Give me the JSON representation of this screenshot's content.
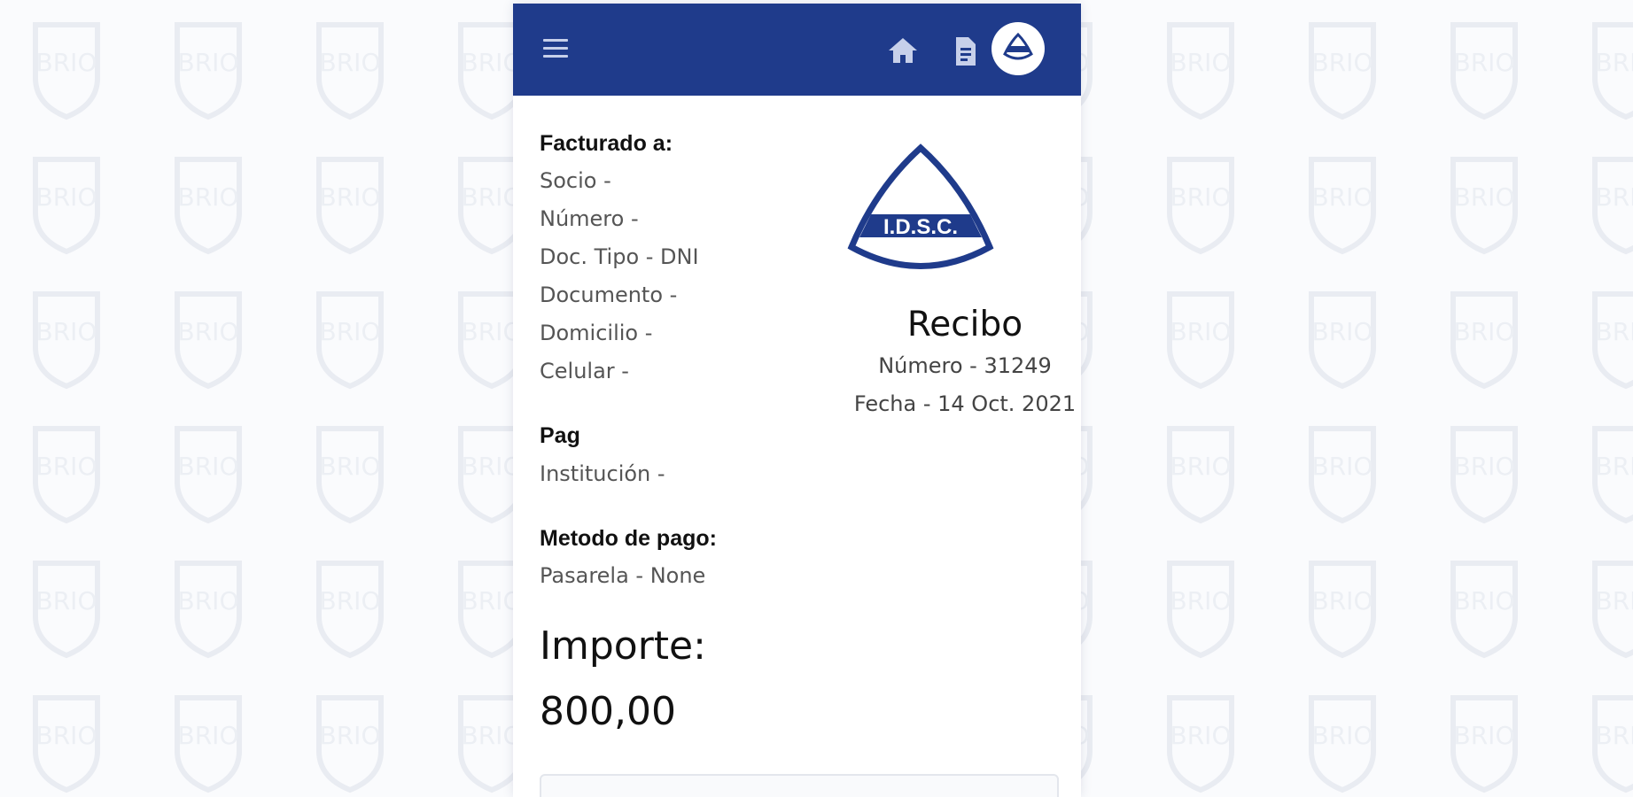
{
  "header": {
    "menu_icon": "hamburger-menu-icon",
    "home_icon": "home-icon",
    "document_icon": "document-icon",
    "avatar_icon": "club-badge-icon",
    "color": "#1f3b8b"
  },
  "logo": {
    "text": "I.D.S.C.",
    "color": "#1f3b8b"
  },
  "billed_to": {
    "heading": "Facturado a:",
    "lines": [
      "Socio -",
      "Número -",
      "Doc. Tipo - DNI",
      "Documento -",
      "Domicilio -",
      "Celular -"
    ]
  },
  "receipt": {
    "title": "Recibo",
    "number": "Número - 31249",
    "date": "Fecha - 14 Oct. 2021"
  },
  "payer": {
    "heading": "Pag",
    "institution": "Institución -"
  },
  "payment_method": {
    "heading": "Metodo de pago:",
    "gateway": "Pasarela - None"
  },
  "amount": {
    "label": "Importe:",
    "value": "800,00"
  },
  "background": {
    "watermark_text": "BRIO"
  }
}
